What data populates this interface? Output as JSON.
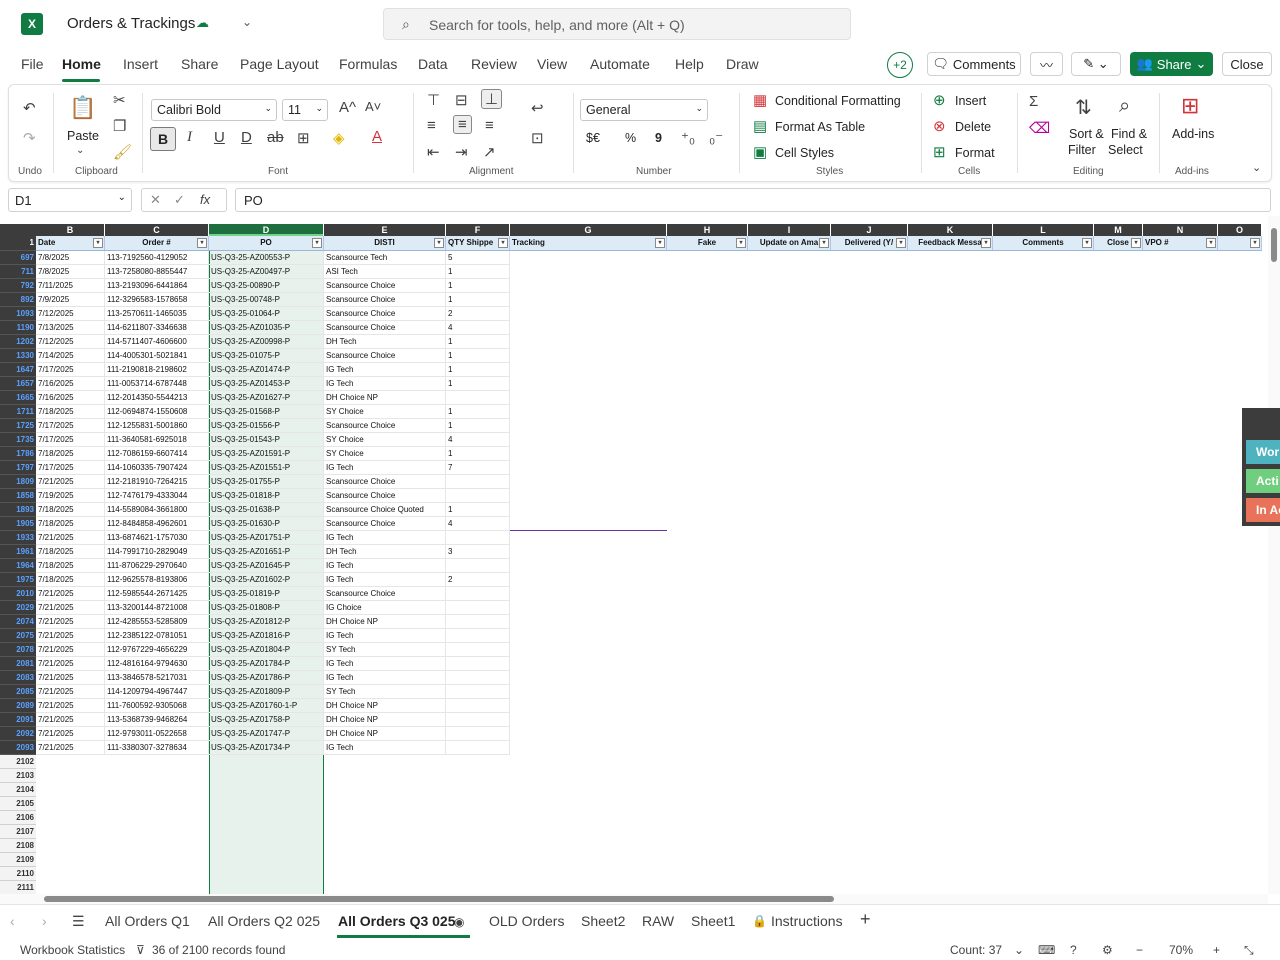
{
  "app": {
    "logo": "X",
    "doc_title": "Orders & Trackings",
    "search_placeholder": "Search for tools, help, and more (Alt + Q)"
  },
  "menu": {
    "tabs": [
      "File",
      "Home",
      "Insert",
      "Share",
      "Page Layout",
      "Formulas",
      "Data",
      "Review",
      "View",
      "Automate",
      "Help",
      "Draw"
    ],
    "active_tab": "Home",
    "presence": "+2",
    "comments_label": "Comments",
    "share_label": "Share",
    "close_label": "Close"
  },
  "ribbon": {
    "undo_label": "Undo",
    "paste_label": "Paste",
    "clipboard_label": "Clipboard",
    "font_name": "Calibri Bold",
    "font_size": "11",
    "font_label": "Font",
    "alignment_label": "Alignment",
    "number_format": "General",
    "number_label": "Number",
    "currency_label": "$€",
    "percent_label": "%",
    "comma_label": "9",
    "conditional_formatting": "Conditional Formatting",
    "format_as_table": "Format As Table",
    "cell_styles": "Cell Styles",
    "styles_label": "Styles",
    "insert_label": "Insert",
    "delete_label": "Delete",
    "format_label": "Format",
    "cells_label": "Cells",
    "sort_label_1": "Sort &",
    "sort_label_2": "Filter",
    "find_label_1": "Find &",
    "find_label_2": "Select",
    "editing_label": "Editing",
    "addins_label": "Add-ins",
    "addins_group": "Add-ins",
    "bold": "B",
    "italic": "I",
    "underline": "U",
    "double_underline": "D",
    "strike": "ab",
    "increase_font": "A^",
    "decrease_font": "A˅",
    "font_color_letter": "A"
  },
  "formula_bar": {
    "name_box": "D1",
    "formula": "PO"
  },
  "grid": {
    "columns": [
      "B",
      "C",
      "D",
      "E",
      "F",
      "G",
      "H",
      "I",
      "J",
      "K",
      "L",
      "M",
      "N",
      "O"
    ],
    "selected_column": "D",
    "header_row_num": "1",
    "headers": [
      "Date",
      "Order #",
      "PO",
      "DISTI",
      "QTY Shippe",
      "Tracking",
      "Fake",
      "Update on Ama",
      "Delivered (Y/",
      "Feedback Messa",
      "Comments",
      "Close",
      "VPO #",
      ""
    ],
    "rows": [
      {
        "n": "697",
        "date": "7/8/2025",
        "order": "113-7192560-4129052",
        "po": "US-Q3-25-AZ00553-P",
        "disti": "Scansource Tech",
        "qty": "5"
      },
      {
        "n": "711",
        "date": "7/8/2025",
        "order": "113-7258080-8855447",
        "po": "US-Q3-25-AZ00497-P",
        "disti": "ASI Tech",
        "qty": "1"
      },
      {
        "n": "792",
        "date": "7/11/2025",
        "order": "113-2193096-6441864",
        "po": "US-Q3-25-00890-P",
        "disti": "Scansource Choice",
        "qty": "1"
      },
      {
        "n": "892",
        "date": "7/9/2025",
        "order": "112-3296583-1578658",
        "po": "US-Q3-25-00748-P",
        "disti": "Scansource Choice",
        "qty": "1"
      },
      {
        "n": "1093",
        "date": "7/12/2025",
        "order": "113-2570611-1465035",
        "po": "US-Q3-25-01064-P",
        "disti": "Scansource Choice",
        "qty": "2"
      },
      {
        "n": "1190",
        "date": "7/13/2025",
        "order": "114-6211807-3346638",
        "po": "US-Q3-25-AZ01035-P",
        "disti": "Scansource Choice",
        "qty": "4"
      },
      {
        "n": "1202",
        "date": "7/12/2025",
        "order": "114-5711407-4606600",
        "po": "US-Q3-25-AZ00998-P",
        "disti": "DH Tech",
        "qty": "1"
      },
      {
        "n": "1330",
        "date": "7/14/2025",
        "order": "114-4005301-5021841",
        "po": "US-Q3-25-01075-P",
        "disti": "Scansource Choice",
        "qty": "1"
      },
      {
        "n": "1647",
        "date": "7/17/2025",
        "order": "111-2190818-2198602",
        "po": "US-Q3-25-AZ01474-P",
        "disti": "IG Tech",
        "qty": "1"
      },
      {
        "n": "1657",
        "date": "7/16/2025",
        "order": "111-0053714-6787448",
        "po": "US-Q3-25-AZ01453-P",
        "disti": "IG Tech",
        "qty": "1"
      },
      {
        "n": "1665",
        "date": "7/16/2025",
        "order": "112-2014350-5544213",
        "po": "US-Q3-25-AZ01627-P",
        "disti": "DH Choice NP",
        "qty": ""
      },
      {
        "n": "1711",
        "date": "7/18/2025",
        "order": "112-0694874-1550608",
        "po": "US-Q3-25-01568-P",
        "disti": "SY Choice",
        "qty": "1"
      },
      {
        "n": "1725",
        "date": "7/17/2025",
        "order": "112-1255831-5001860",
        "po": "US-Q3-25-01556-P",
        "disti": "Scansource Choice",
        "qty": "1"
      },
      {
        "n": "1735",
        "date": "7/17/2025",
        "order": "111-3640581-6925018",
        "po": "US-Q3-25-01543-P",
        "disti": "SY Choice",
        "qty": "4"
      },
      {
        "n": "1786",
        "date": "7/18/2025",
        "order": "112-7086159-6607414",
        "po": "US-Q3-25-AZ01591-P",
        "disti": "SY Choice",
        "qty": "1"
      },
      {
        "n": "1797",
        "date": "7/17/2025",
        "order": "114-1060335-7907424",
        "po": "US-Q3-25-AZ01551-P",
        "disti": "IG Tech",
        "qty": "7"
      },
      {
        "n": "1809",
        "date": "7/21/2025",
        "order": "112-2181910-7264215",
        "po": "US-Q3-25-01755-P",
        "disti": "Scansource Choice",
        "qty": ""
      },
      {
        "n": "1858",
        "date": "7/19/2025",
        "order": "112-7476179-4333044",
        "po": "US-Q3-25-01818-P",
        "disti": "Scansource Choice",
        "qty": ""
      },
      {
        "n": "1893",
        "date": "7/18/2025",
        "order": "114-5589084-3661800",
        "po": "US-Q3-25-01638-P",
        "disti": "Scansource Choice Quoted",
        "qty": "1"
      },
      {
        "n": "1905",
        "date": "7/18/2025",
        "order": "112-8484858-4962601",
        "po": "US-Q3-25-01630-P",
        "disti": "Scansource Choice",
        "qty": "4"
      },
      {
        "n": "1933",
        "date": "7/21/2025",
        "order": "113-6874621-1757030",
        "po": "US-Q3-25-AZ01751-P",
        "disti": "IG Tech",
        "qty": ""
      },
      {
        "n": "1961",
        "date": "7/18/2025",
        "order": "114-7991710-2829049",
        "po": "US-Q3-25-AZ01651-P",
        "disti": "DH Tech",
        "qty": "3"
      },
      {
        "n": "1964",
        "date": "7/18/2025",
        "order": "111-8706229-2970640",
        "po": "US-Q3-25-AZ01645-P",
        "disti": "IG Tech",
        "qty": ""
      },
      {
        "n": "1975",
        "date": "7/18/2025",
        "order": "112-9625578-8193806",
        "po": "US-Q3-25-AZ01602-P",
        "disti": "IG Tech",
        "qty": "2"
      },
      {
        "n": "2010",
        "date": "7/21/2025",
        "order": "112-5985544-2671425",
        "po": "US-Q3-25-01819-P",
        "disti": "Scansource Choice",
        "qty": ""
      },
      {
        "n": "2029",
        "date": "7/21/2025",
        "order": "113-3200144-8721008",
        "po": "US-Q3-25-01808-P",
        "disti": "IG Choice",
        "qty": ""
      },
      {
        "n": "2074",
        "date": "7/21/2025",
        "order": "112-4285553-5285809",
        "po": "US-Q3-25-AZ01812-P",
        "disti": "DH Choice NP",
        "qty": ""
      },
      {
        "n": "2075",
        "date": "7/21/2025",
        "order": "112-2385122-0781051",
        "po": "US-Q3-25-AZ01816-P",
        "disti": "IG Tech",
        "qty": ""
      },
      {
        "n": "2078",
        "date": "7/21/2025",
        "order": "112-9767229-4656229",
        "po": "US-Q3-25-AZ01804-P",
        "disti": "SY Tech",
        "qty": ""
      },
      {
        "n": "2081",
        "date": "7/21/2025",
        "order": "112-4816164-9794630",
        "po": "US-Q3-25-AZ01784-P",
        "disti": "IG Tech",
        "qty": ""
      },
      {
        "n": "2083",
        "date": "7/21/2025",
        "order": "113-3846578-5217031",
        "po": "US-Q3-25-AZ01786-P",
        "disti": "IG Tech",
        "qty": ""
      },
      {
        "n": "2085",
        "date": "7/21/2025",
        "order": "114-1209794-4967447",
        "po": "US-Q3-25-AZ01809-P",
        "disti": "SY Tech",
        "qty": ""
      },
      {
        "n": "2089",
        "date": "7/21/2025",
        "order": "111-7600592-9305068",
        "po": "US-Q3-25-AZ01760-1-P",
        "disti": "DH Choice NP",
        "qty": ""
      },
      {
        "n": "2091",
        "date": "7/21/2025",
        "order": "113-5368739-9468264",
        "po": "US-Q3-25-AZ01758-P",
        "disti": "DH Choice NP",
        "qty": ""
      },
      {
        "n": "2092",
        "date": "7/21/2025",
        "order": "112-9793011-0522658",
        "po": "US-Q3-25-AZ01747-P",
        "disti": "DH Choice NP",
        "qty": ""
      },
      {
        "n": "2093",
        "date": "7/21/2025",
        "order": "111-3380307-3278634",
        "po": "US-Q3-25-AZ01734-P",
        "disti": "IG Tech",
        "qty": ""
      }
    ],
    "empty_rows": [
      "2102",
      "2103",
      "2104",
      "2105",
      "2106",
      "2107",
      "2108",
      "2109",
      "2110",
      "2111"
    ]
  },
  "side_panel": {
    "items": [
      {
        "label": "Wor",
        "color": "#4fb3bf"
      },
      {
        "label": "Acti",
        "color": "#6fcf7f"
      },
      {
        "label": "In Ac",
        "color": "#e8735a"
      }
    ]
  },
  "sheets": {
    "tabs": [
      "All Orders Q1",
      "All Orders Q2 025",
      "All Orders Q3 025",
      "OLD Orders",
      "Sheet2",
      "RAW",
      "Sheet1",
      "Instructions"
    ],
    "active": "All Orders Q3 025"
  },
  "status": {
    "workbook_stats": "Workbook Statistics",
    "records": "36 of 2100 records found",
    "count": "Count: 37",
    "zoom": "70%"
  },
  "colors": {
    "accent": "#107c41",
    "header_fill": "#ddebf7"
  }
}
